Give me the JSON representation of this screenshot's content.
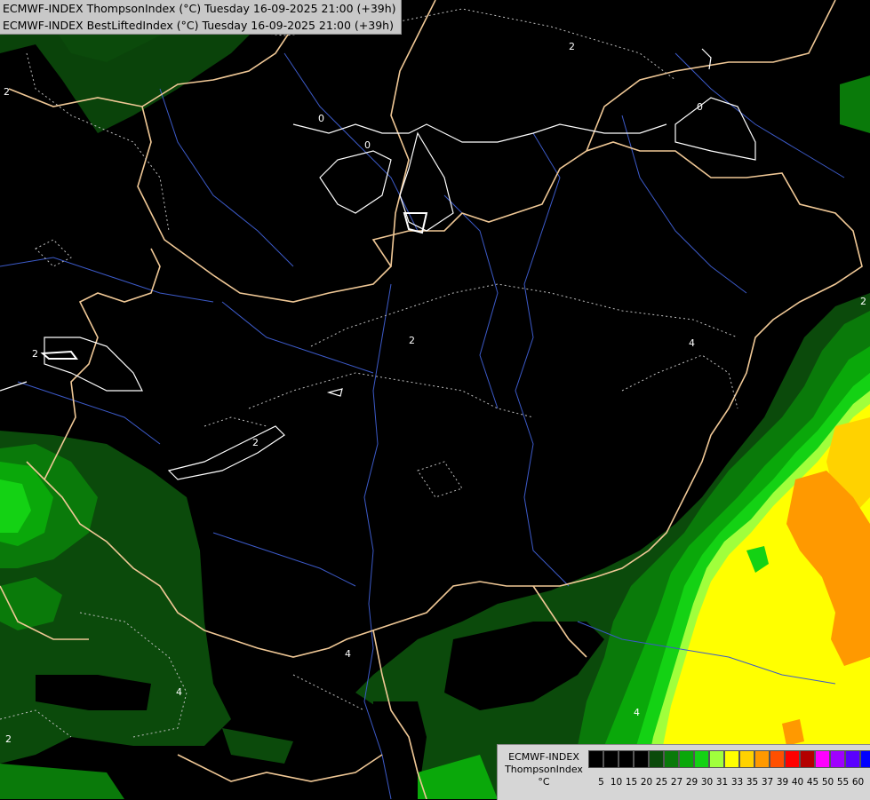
{
  "header": {
    "line1": "ECMWF-INDEX ThompsonIndex (°C) Tuesday 16-09-2025 21:00 (+39h)",
    "line2": "ECMWF-INDEX BestLiftedIndex (°C) Tuesday 16-09-2025 21:00 (+39h)"
  },
  "legend": {
    "title_line1": "ECMWF-INDEX",
    "title_line2": "ThompsonIndex",
    "unit": "°C",
    "ticks": [
      "5",
      "10",
      "15",
      "20",
      "25",
      "27",
      "29",
      "30",
      "31",
      "33",
      "35",
      "37",
      "39",
      "40",
      "45",
      "50",
      "55",
      "60"
    ],
    "colors": [
      "#000000",
      "#000000",
      "#000000",
      "#000000",
      "#0b4a0b",
      "#0a7a0a",
      "#0aa80a",
      "#14d214",
      "#a0ff3c",
      "#ffff00",
      "#ffd200",
      "#ff9900",
      "#ff5000",
      "#ff0000",
      "#b40000",
      "#ff00ff",
      "#a000ff",
      "#5a00ff",
      "#0000ff"
    ]
  },
  "contour_labels": [
    "0",
    "0",
    "0",
    "2",
    "2",
    "2",
    "2",
    "2",
    "2",
    "2",
    "4",
    "4",
    "4",
    "4"
  ],
  "colors": {
    "background": "#000000",
    "border": "#f0c896",
    "river": "#3c5ac8",
    "contour": "#ffffff"
  }
}
